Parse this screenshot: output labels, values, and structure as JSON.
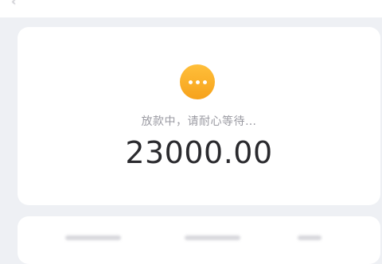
{
  "loan_status": {
    "message": "放款中，请耐心等待…",
    "amount": "23000.00",
    "icon": "more-dots-icon",
    "icon_color": "#f7a61f"
  }
}
